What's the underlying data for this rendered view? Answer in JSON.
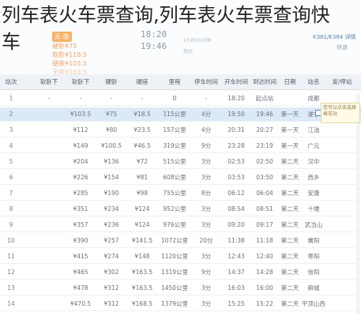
{
  "title": {
    "line1": "列车表火车票查询,列车表火车票查询快",
    "line2": "车"
  },
  "header": {
    "seat_label": "无 座",
    "prices": [
      "硬卧¥75",
      "软卧¥118.5",
      "硬座¥103.5"
    ],
    "price_note": "无座¥103.5",
    "depart_time": "18:20",
    "arrive_time": "19:46",
    "depart_label": "1小时26分钟",
    "arrive_label": "到达",
    "train_no": "K381/K384 详情",
    "train_sub": "快速"
  },
  "table": {
    "columns": [
      "发/停站",
      "站名",
      "日期",
      "到达时间",
      "开车时间",
      "停车时间",
      "里程",
      "硬座",
      "硬卧",
      "软卧下",
      "软卧下",
      "站次"
    ],
    "rows": [
      [
        "",
        "成都",
        "",
        "起点站",
        "18:20",
        "-",
        "0",
        "-",
        "-",
        "-",
        "-",
        "1"
      ],
      [
        "",
        "遂宁",
        "第一天",
        "19:46",
        "19:50",
        "4分",
        "115公里",
        "¥18.5",
        "¥75",
        "¥103.5",
        "",
        "2"
      ],
      [
        "",
        "江油",
        "第一天",
        "20:27",
        "20:31",
        "4分",
        "157公里",
        "¥23.5",
        "¥80",
        "¥112",
        "",
        "3"
      ],
      [
        "",
        "广元",
        "第一天",
        "23:19",
        "23:28",
        "9分",
        "319公里",
        "¥46.5",
        "¥100.5",
        "¥149",
        "",
        "4"
      ],
      [
        "",
        "汉中",
        "第二天",
        "02:50",
        "02:53",
        "3分",
        "515公里",
        "¥72",
        "¥136",
        "¥204",
        "",
        "5"
      ],
      [
        "",
        "西乡",
        "第二天",
        "03:50",
        "03:53",
        "3分",
        "608公里",
        "¥81",
        "¥154",
        "¥226",
        "",
        "6"
      ],
      [
        "",
        "安康",
        "第二天",
        "06:04",
        "06:12",
        "8分",
        "755公里",
        "¥98",
        "¥190",
        "¥285",
        "",
        "7"
      ],
      [
        "",
        "十堰",
        "第二天",
        "08:51",
        "08:54",
        "3分",
        "952公里",
        "¥124",
        "¥234",
        "¥351",
        "",
        "8"
      ],
      [
        "",
        "武当山",
        "第二天",
        "09:17",
        "09:20",
        "3分",
        "976公里",
        "¥124",
        "¥236",
        "¥357",
        "",
        "9"
      ],
      [
        "",
        "襄阳",
        "第二天",
        "11:18",
        "11:38",
        "20分",
        "1072公里",
        "¥141.5",
        "¥257",
        "¥390",
        "",
        "10"
      ],
      [
        "",
        "枣阳",
        "第二天",
        "12:40",
        "12:43",
        "3分",
        "1120公里",
        "¥148",
        "¥274",
        "¥415",
        "",
        "11"
      ],
      [
        "",
        "信阳",
        "第二天",
        "14:28",
        "14:37",
        "9分",
        "1319公里",
        "¥163.5",
        "¥302",
        "¥465",
        "",
        "12"
      ],
      [
        "",
        "麻城",
        "第二天",
        "16:00",
        "16:03",
        "3分",
        "1450公里",
        "¥163.5",
        "¥312",
        "¥478",
        "",
        "13"
      ],
      [
        "",
        "平顶山西",
        "第二天",
        "15:22",
        "15:25",
        "3分",
        "1379公里",
        "¥168.5",
        "¥312",
        "¥470.5",
        "",
        "14"
      ]
    ]
  },
  "tooltip": "您可以点击选择乘车站"
}
